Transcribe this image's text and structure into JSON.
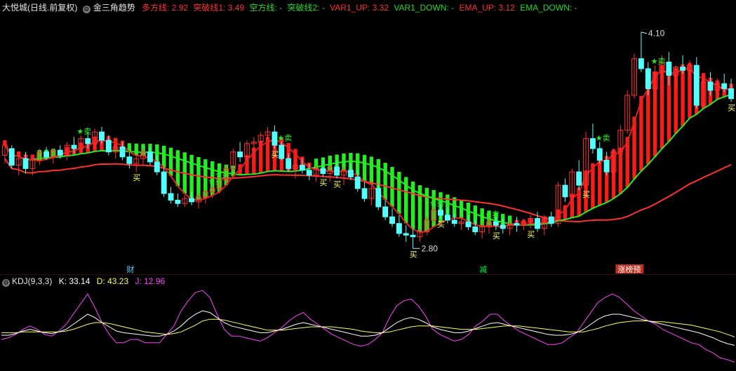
{
  "header": {
    "stock_name": "大悦城",
    "period": "(日线.前复权)",
    "indicator_name": "金三角趋势",
    "duo_fang_xian": "多方线: 2.92",
    "tu_po_xian1": "突破线1: 3.49",
    "kong_fang_xian": "空方线: -",
    "tu_po_xian2": "突破线2: -",
    "var1_up": "VAR1_UP: 3.32",
    "var1_down": "VAR1_DOWN: -",
    "ema_up": "EMA_UP: 3.12",
    "ema_down": "EMA_DOWN: -"
  },
  "kdj": {
    "name": "KDJ(9,3,3)",
    "k": "K: 33.14",
    "d": "D: 43.23",
    "j": "J: 12.96"
  },
  "annotations": {
    "high_price": "4.10",
    "low_price": "2.80",
    "labels": [
      "财",
      "减",
      "涨榜预"
    ],
    "buy": "买",
    "sell": "卖",
    "star": "★"
  },
  "colors": {
    "up": "#ff3030",
    "down": "#54ffff",
    "green": "#22ee22",
    "red_fill": "#ff1a1a",
    "k_line": "#ffffff",
    "d_line": "#ffff55",
    "j_line": "#ff44ff",
    "header_red": "#ff3030",
    "header_green": "#00dd00"
  },
  "chart_data": {
    "type": "candlestick",
    "price_range": [
      2.7,
      4.2
    ],
    "candles": [
      [
        3.36,
        3.43,
        3.31,
        3.42
      ],
      [
        3.4,
        3.42,
        3.28,
        3.3
      ],
      [
        3.3,
        3.36,
        3.24,
        3.34
      ],
      [
        3.34,
        3.38,
        3.25,
        3.28
      ],
      [
        3.28,
        3.35,
        3.24,
        3.33
      ],
      [
        3.33,
        3.4,
        3.3,
        3.38
      ],
      [
        3.38,
        3.41,
        3.33,
        3.35
      ],
      [
        3.35,
        3.4,
        3.31,
        3.39
      ],
      [
        3.39,
        3.42,
        3.34,
        3.36
      ],
      [
        3.36,
        3.44,
        3.33,
        3.42
      ],
      [
        3.42,
        3.47,
        3.37,
        3.4
      ],
      [
        3.4,
        3.48,
        3.38,
        3.46
      ],
      [
        3.46,
        3.5,
        3.4,
        3.43
      ],
      [
        3.43,
        3.52,
        3.4,
        3.5
      ],
      [
        3.5,
        3.53,
        3.43,
        3.45
      ],
      [
        3.45,
        3.48,
        3.36,
        3.38
      ],
      [
        3.38,
        3.43,
        3.34,
        3.41
      ],
      [
        3.41,
        3.44,
        3.33,
        3.35
      ],
      [
        3.35,
        3.38,
        3.28,
        3.31
      ],
      [
        3.31,
        3.36,
        3.26,
        3.34
      ],
      [
        3.34,
        3.4,
        3.3,
        3.38
      ],
      [
        3.38,
        3.41,
        3.3,
        3.32
      ],
      [
        3.32,
        3.36,
        3.24,
        3.26
      ],
      [
        3.26,
        3.29,
        3.11,
        3.13
      ],
      [
        3.13,
        3.17,
        3.07,
        3.09
      ],
      [
        3.09,
        3.13,
        3.05,
        3.07
      ],
      [
        3.07,
        3.12,
        3.05,
        3.1
      ],
      [
        3.1,
        3.14,
        3.06,
        3.08
      ],
      [
        3.08,
        3.13,
        3.04,
        3.11
      ],
      [
        3.11,
        3.15,
        3.07,
        3.14
      ],
      [
        3.14,
        3.18,
        3.1,
        3.16
      ],
      [
        3.16,
        3.22,
        3.13,
        3.21
      ],
      [
        3.21,
        3.3,
        3.18,
        3.28
      ],
      [
        3.28,
        3.4,
        3.26,
        3.38
      ],
      [
        3.38,
        3.44,
        3.32,
        3.35
      ],
      [
        3.35,
        3.45,
        3.32,
        3.43
      ],
      [
        3.43,
        3.47,
        3.38,
        3.44
      ],
      [
        3.44,
        3.5,
        3.4,
        3.48
      ],
      [
        3.48,
        3.53,
        3.45,
        3.5
      ],
      [
        3.5,
        3.54,
        3.4,
        3.42
      ],
      [
        3.42,
        3.44,
        3.33,
        3.34
      ],
      [
        3.34,
        3.37,
        3.26,
        3.28
      ],
      [
        3.28,
        3.32,
        3.22,
        3.3
      ],
      [
        3.3,
        3.34,
        3.25,
        3.27
      ],
      [
        3.27,
        3.31,
        3.21,
        3.24
      ],
      [
        3.24,
        3.3,
        3.2,
        3.28
      ],
      [
        3.28,
        3.33,
        3.23,
        3.25
      ],
      [
        3.25,
        3.3,
        3.2,
        3.29
      ],
      [
        3.29,
        3.33,
        3.22,
        3.24
      ],
      [
        3.24,
        3.29,
        3.18,
        3.27
      ],
      [
        3.27,
        3.31,
        3.21,
        3.23
      ],
      [
        3.23,
        3.27,
        3.14,
        3.16
      ],
      [
        3.16,
        3.2,
        3.08,
        3.1
      ],
      [
        3.1,
        3.18,
        3.06,
        3.16
      ],
      [
        3.16,
        3.19,
        3.03,
        3.05
      ],
      [
        3.05,
        3.09,
        2.97,
        2.99
      ],
      [
        2.99,
        3.04,
        2.93,
        2.95
      ],
      [
        2.95,
        3.0,
        2.87,
        2.89
      ],
      [
        2.89,
        2.94,
        2.84,
        2.88
      ],
      [
        2.88,
        2.92,
        2.8,
        2.87
      ],
      [
        2.87,
        2.92,
        2.84,
        2.9
      ],
      [
        2.9,
        2.99,
        2.88,
        2.97
      ],
      [
        2.97,
        3.05,
        2.95,
        3.03
      ],
      [
        3.03,
        3.07,
        2.98,
        3.0
      ],
      [
        3.0,
        3.04,
        2.95,
        2.97
      ],
      [
        2.97,
        3.01,
        2.93,
        2.95
      ],
      [
        2.95,
        2.99,
        2.91,
        2.96
      ],
      [
        2.96,
        3.0,
        2.91,
        2.93
      ],
      [
        2.93,
        2.97,
        2.88,
        2.9
      ],
      [
        2.9,
        2.95,
        2.86,
        2.93
      ],
      [
        2.93,
        2.98,
        2.89,
        2.96
      ],
      [
        2.96,
        2.99,
        2.91,
        2.94
      ],
      [
        2.94,
        2.98,
        2.89,
        2.92
      ],
      [
        2.92,
        2.97,
        2.88,
        2.95
      ],
      [
        2.95,
        2.99,
        2.9,
        2.94
      ],
      [
        2.94,
        2.98,
        2.91,
        2.96
      ],
      [
        2.96,
        3.0,
        2.92,
        2.98
      ],
      [
        2.98,
        3.02,
        2.9,
        2.92
      ],
      [
        2.92,
        3.0,
        2.88,
        2.99
      ],
      [
        2.99,
        3.02,
        2.93,
        2.95
      ],
      [
        2.95,
        3.2,
        2.93,
        3.18
      ],
      [
        3.18,
        3.22,
        3.08,
        3.11
      ],
      [
        3.11,
        3.28,
        3.09,
        3.26
      ],
      [
        3.26,
        3.33,
        3.15,
        3.18
      ],
      [
        3.18,
        3.5,
        3.16,
        3.46
      ],
      [
        3.46,
        3.55,
        3.37,
        3.4
      ],
      [
        3.4,
        3.44,
        3.31,
        3.33
      ],
      [
        3.33,
        3.38,
        3.24,
        3.26
      ],
      [
        3.26,
        3.4,
        3.24,
        3.38
      ],
      [
        3.38,
        3.54,
        3.36,
        3.51
      ],
      [
        3.51,
        3.75,
        3.49,
        3.72
      ],
      [
        3.72,
        3.97,
        3.7,
        3.94
      ],
      [
        3.94,
        4.1,
        3.86,
        3.88
      ],
      [
        3.88,
        3.92,
        3.72,
        3.76
      ],
      [
        3.76,
        3.9,
        3.7,
        3.86
      ],
      [
        3.86,
        3.96,
        3.8,
        3.92
      ],
      [
        3.92,
        3.98,
        3.78,
        3.84
      ],
      [
        3.84,
        3.9,
        3.78,
        3.89
      ],
      [
        3.89,
        3.96,
        3.85,
        3.87
      ],
      [
        3.87,
        3.93,
        3.82,
        3.9
      ],
      [
        3.9,
        3.95,
        3.64,
        3.66
      ],
      [
        3.66,
        3.83,
        3.64,
        3.8
      ],
      [
        3.8,
        3.86,
        3.72,
        3.75
      ],
      [
        3.75,
        3.82,
        3.7,
        3.79
      ],
      [
        3.79,
        3.85,
        3.74,
        3.76
      ],
      [
        3.76,
        3.82,
        3.68,
        3.7
      ]
    ],
    "kdj_series": {
      "k": [
        45,
        45,
        47,
        50,
        52,
        50,
        48,
        47,
        49,
        52,
        58,
        64,
        70,
        66,
        60,
        55,
        50,
        48,
        47,
        46,
        45,
        44,
        44,
        46,
        50,
        56,
        64,
        70,
        74,
        72,
        66,
        60,
        56,
        54,
        52,
        50,
        48,
        48,
        50,
        52,
        55,
        58,
        60,
        58,
        56,
        54,
        52,
        50,
        48,
        46,
        44,
        44,
        45,
        48,
        54,
        60,
        64,
        66,
        64,
        60,
        55,
        52,
        50,
        48,
        48,
        50,
        53,
        56,
        59,
        60,
        58,
        56,
        54,
        52,
        50,
        48,
        46,
        45,
        45,
        46,
        48,
        52,
        58,
        64,
        68,
        70,
        70,
        68,
        66,
        64,
        62,
        60,
        58,
        56,
        54,
        52,
        50,
        48,
        45,
        42,
        38,
        35,
        33
      ],
      "d": [
        48,
        48,
        48,
        49,
        49,
        49,
        49,
        49,
        49,
        50,
        52,
        55,
        58,
        60,
        60,
        59,
        57,
        55,
        53,
        51,
        49,
        48,
        47,
        46,
        47,
        49,
        53,
        57,
        62,
        64,
        64,
        63,
        61,
        59,
        57,
        55,
        53,
        51,
        51,
        51,
        52,
        53,
        54,
        55,
        55,
        55,
        55,
        54,
        53,
        52,
        50,
        49,
        48,
        48,
        49,
        51,
        53,
        55,
        56,
        56,
        56,
        55,
        54,
        53,
        52,
        52,
        52,
        53,
        54,
        55,
        56,
        56,
        56,
        55,
        54,
        53,
        52,
        51,
        50,
        49,
        49,
        49,
        51,
        53,
        56,
        58,
        60,
        61,
        62,
        62,
        62,
        61,
        61,
        60,
        59,
        58,
        57,
        55,
        53,
        51,
        49,
        46,
        43
      ],
      "j": [
        40,
        42,
        46,
        52,
        56,
        52,
        46,
        44,
        50,
        58,
        70,
        82,
        94,
        78,
        60,
        46,
        36,
        36,
        40,
        40,
        36,
        36,
        36,
        46,
        56,
        74,
        86,
        96,
        98,
        90,
        70,
        52,
        44,
        44,
        42,
        40,
        38,
        42,
        48,
        54,
        62,
        68,
        72,
        64,
        58,
        52,
        46,
        42,
        38,
        34,
        32,
        34,
        40,
        48,
        66,
        80,
        86,
        88,
        80,
        68,
        52,
        46,
        42,
        38,
        40,
        46,
        56,
        62,
        70,
        70,
        62,
        56,
        50,
        46,
        42,
        38,
        34,
        34,
        36,
        42,
        48,
        60,
        72,
        84,
        90,
        94,
        90,
        82,
        74,
        68,
        62,
        58,
        52,
        48,
        44,
        40,
        36,
        34,
        28,
        24,
        18,
        16,
        13
      ]
    }
  }
}
